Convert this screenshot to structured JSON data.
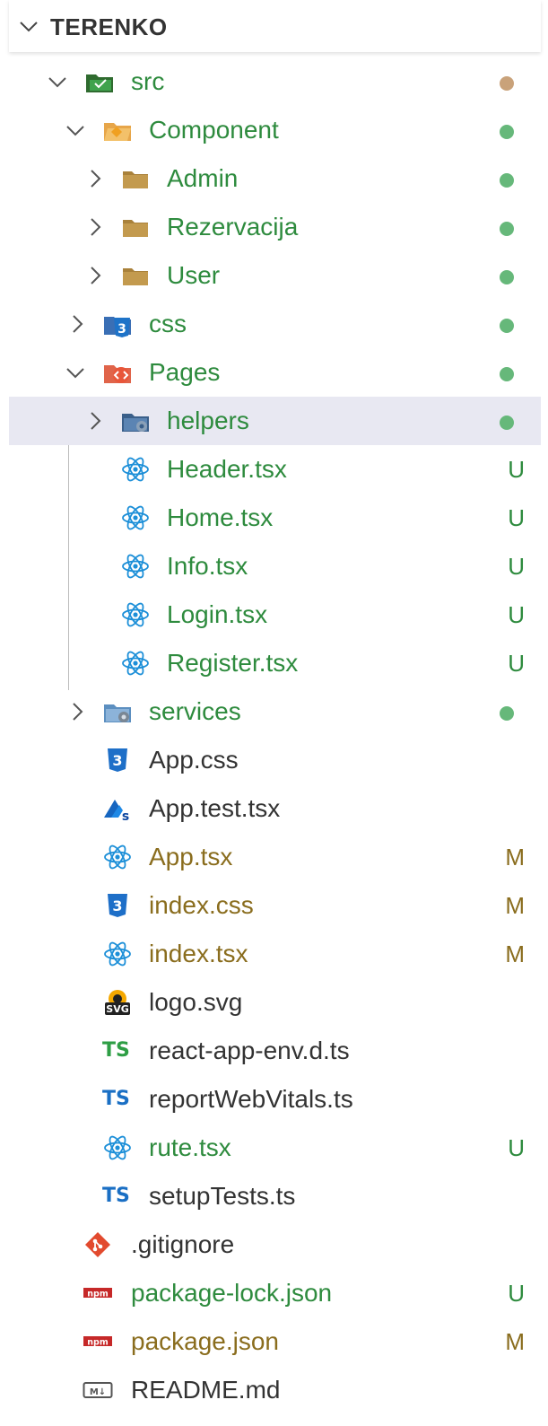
{
  "section": {
    "title": "TERENKO"
  },
  "rows": [
    {
      "label": "src",
      "badge": "●",
      "badge_color": "#c9a27a",
      "label_color": "#2e8b3e",
      "icon": "folder-src-icon"
    },
    {
      "label": "Component",
      "badge": "●",
      "badge_color": "#66b87a",
      "label_color": "#2e8b3e",
      "icon": "folder-component-icon"
    },
    {
      "label": "Admin",
      "badge": "●",
      "badge_color": "#66b87a",
      "label_color": "#2e8b3e",
      "icon": "folder-icon"
    },
    {
      "label": "Rezervacija",
      "badge": "●",
      "badge_color": "#66b87a",
      "label_color": "#2e8b3e",
      "icon": "folder-icon"
    },
    {
      "label": "User",
      "badge": "●",
      "badge_color": "#66b87a",
      "label_color": "#2e8b3e",
      "icon": "folder-icon"
    },
    {
      "label": "css",
      "badge": "●",
      "badge_color": "#66b87a",
      "label_color": "#2e8b3e",
      "icon": "folder-css-icon"
    },
    {
      "label": "Pages",
      "badge": "●",
      "badge_color": "#66b87a",
      "label_color": "#2e8b3e",
      "icon": "folder-pages-icon"
    },
    {
      "label": "helpers",
      "badge": "●",
      "badge_color": "#66b87a",
      "label_color": "#2e8b3e",
      "icon": "folder-helpers-icon"
    },
    {
      "label": "Header.tsx",
      "badge": "U",
      "badge_color": "#2e8b3e",
      "label_color": "#2e8b3e",
      "icon": "react-icon"
    },
    {
      "label": "Home.tsx",
      "badge": "U",
      "badge_color": "#2e8b3e",
      "label_color": "#2e8b3e",
      "icon": "react-icon"
    },
    {
      "label": "Info.tsx",
      "badge": "U",
      "badge_color": "#2e8b3e",
      "label_color": "#2e8b3e",
      "icon": "react-icon"
    },
    {
      "label": "Login.tsx",
      "badge": "U",
      "badge_color": "#2e8b3e",
      "label_color": "#2e8b3e",
      "icon": "react-icon"
    },
    {
      "label": "Register.tsx",
      "badge": "U",
      "badge_color": "#2e8b3e",
      "label_color": "#2e8b3e",
      "icon": "react-icon"
    },
    {
      "label": "services",
      "badge": "●",
      "badge_color": "#66b87a",
      "label_color": "#2e8b3e",
      "icon": "folder-services-icon"
    },
    {
      "label": "App.css",
      "badge": "",
      "badge_color": "",
      "label_color": "#333333",
      "icon": "css3-icon"
    },
    {
      "label": "App.test.tsx",
      "badge": "",
      "badge_color": "",
      "label_color": "#333333",
      "icon": "test-icon"
    },
    {
      "label": "App.tsx",
      "badge": "M",
      "badge_color": "#8a6d1e",
      "label_color": "#8a6d1e",
      "icon": "react-icon"
    },
    {
      "label": "index.css",
      "badge": "M",
      "badge_color": "#8a6d1e",
      "label_color": "#8a6d1e",
      "icon": "css3-icon"
    },
    {
      "label": "index.tsx",
      "badge": "M",
      "badge_color": "#8a6d1e",
      "label_color": "#8a6d1e",
      "icon": "react-icon"
    },
    {
      "label": "logo.svg",
      "badge": "",
      "badge_color": "",
      "label_color": "#333333",
      "icon": "svg-icon"
    },
    {
      "label": "react-app-env.d.ts",
      "badge": "",
      "badge_color": "",
      "label_color": "#333333",
      "icon": "ts-green-icon"
    },
    {
      "label": "reportWebVitals.ts",
      "badge": "",
      "badge_color": "",
      "label_color": "#333333",
      "icon": "ts-icon"
    },
    {
      "label": "rute.tsx",
      "badge": "U",
      "badge_color": "#2e8b3e",
      "label_color": "#2e8b3e",
      "icon": "react-icon"
    },
    {
      "label": "setupTests.ts",
      "badge": "",
      "badge_color": "",
      "label_color": "#333333",
      "icon": "ts-icon"
    },
    {
      "label": ".gitignore",
      "badge": "",
      "badge_color": "",
      "label_color": "#333333",
      "icon": "git-icon"
    },
    {
      "label": "package-lock.json",
      "badge": "U",
      "badge_color": "#2e8b3e",
      "label_color": "#2e8b3e",
      "icon": "npm-icon"
    },
    {
      "label": "package.json",
      "badge": "M",
      "badge_color": "#8a6d1e",
      "label_color": "#8a6d1e",
      "icon": "npm-icon"
    },
    {
      "label": "README.md",
      "badge": "",
      "badge_color": "",
      "label_color": "#333333",
      "icon": "markdown-icon"
    }
  ]
}
